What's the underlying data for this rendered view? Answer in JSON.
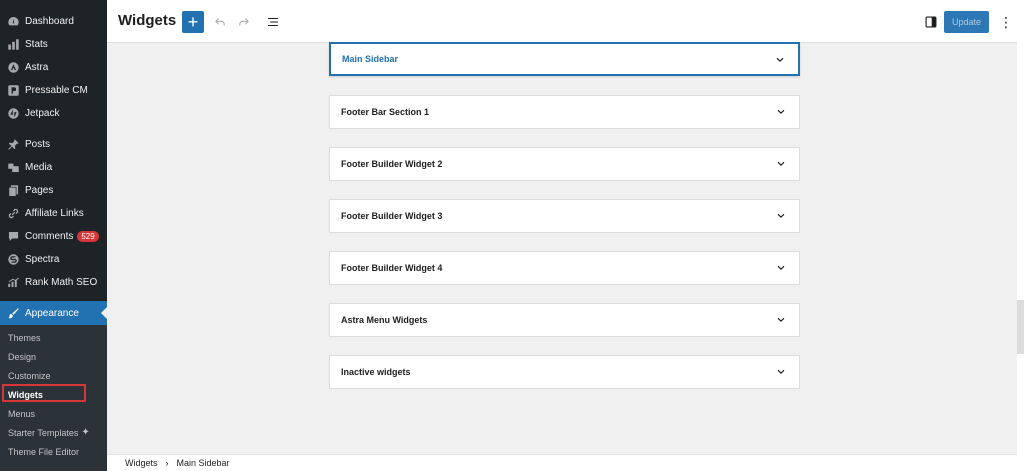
{
  "sidebar": {
    "items": [
      {
        "label": "Dashboard",
        "icon": "dashboard-icon"
      },
      {
        "label": "Stats",
        "icon": "stats-icon"
      },
      {
        "label": "Astra",
        "icon": "astra-icon"
      },
      {
        "label": "Pressable CM",
        "icon": "pressable-icon"
      },
      {
        "label": "Jetpack",
        "icon": "jetpack-icon"
      },
      {
        "label": "Posts",
        "icon": "pin-icon"
      },
      {
        "label": "Media",
        "icon": "media-icon"
      },
      {
        "label": "Pages",
        "icon": "pages-icon"
      },
      {
        "label": "Affiliate Links",
        "icon": "link-icon"
      },
      {
        "label": "Comments",
        "icon": "comment-icon",
        "badge": "529"
      },
      {
        "label": "Spectra",
        "icon": "spectra-icon"
      },
      {
        "label": "Rank Math SEO",
        "icon": "rankmath-icon"
      }
    ],
    "appearance": {
      "label": "Appearance",
      "icon": "paintbrush-icon"
    },
    "submenu": [
      {
        "label": "Themes"
      },
      {
        "label": "Design"
      },
      {
        "label": "Customize"
      },
      {
        "label": "Widgets",
        "current": true
      },
      {
        "label": "Menus"
      },
      {
        "label": "Starter Templates"
      },
      {
        "label": "Theme File Editor"
      }
    ]
  },
  "toolbar": {
    "title": "Widgets",
    "add_label": "+",
    "update_label": "Update"
  },
  "widget_areas": [
    {
      "label": "Main Sidebar",
      "selected": true
    },
    {
      "label": "Footer Bar Section 1"
    },
    {
      "label": "Footer Builder Widget 2"
    },
    {
      "label": "Footer Builder Widget 3"
    },
    {
      "label": "Footer Builder Widget 4"
    },
    {
      "label": "Astra Menu Widgets"
    },
    {
      "label": "Inactive widgets"
    }
  ],
  "breadcrumb": {
    "root": "Widgets",
    "current": "Main Sidebar"
  },
  "colors": {
    "accent": "#2271b1",
    "sidebar_bg": "#1d2327",
    "submenu_bg": "#2c3338",
    "badge": "#d63638",
    "highlight": "#d63638"
  }
}
